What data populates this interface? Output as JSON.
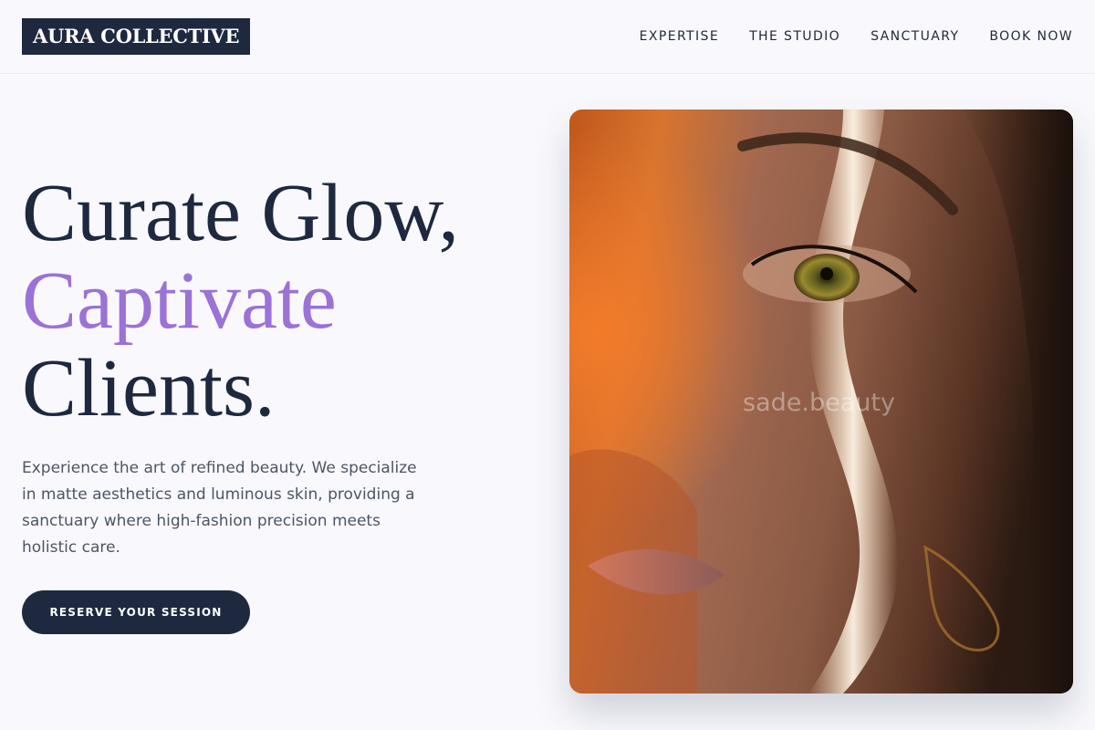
{
  "header": {
    "logo": "AURA COLLECTIVE",
    "nav": [
      {
        "label": "EXPERTISE"
      },
      {
        "label": "THE STUDIO"
      },
      {
        "label": "SANCTUARY"
      },
      {
        "label": "BOOK NOW"
      }
    ]
  },
  "hero": {
    "title_line1": "Curate Glow,",
    "title_line2": "Captivate",
    "title_line3": "Clients.",
    "description": "Experience the art of refined beauty. We specialize in matte aesthetics and luminous skin, providing a sanctuary where high-fashion precision meets holistic care.",
    "cta_label": "RESERVE YOUR SESSION",
    "accent_color": "#9b72d6",
    "primary_color": "#1e2940"
  },
  "image": {
    "watermark": "sade.beauty",
    "subject": "portrait-photo"
  }
}
